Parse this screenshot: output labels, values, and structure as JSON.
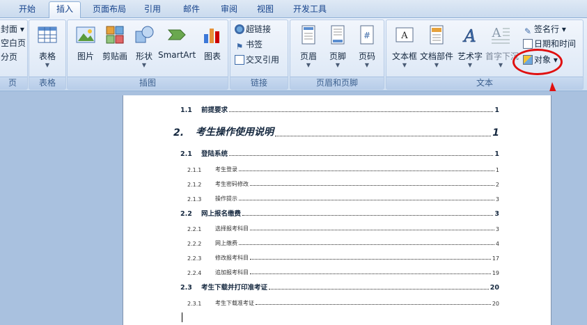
{
  "tabs": [
    "开始",
    "插入",
    "页面布局",
    "引用",
    "邮件",
    "审阅",
    "视图",
    "开发工具"
  ],
  "active_tab": "插入",
  "ribbon": {
    "pages_partial": [
      "封面",
      "空白页",
      "分页"
    ],
    "pages_label": "页",
    "table_group": {
      "button": "表格",
      "label": "表格"
    },
    "illustrations": {
      "buttons": [
        "图片",
        "剪贴画",
        "形状",
        "SmartArt",
        "图表"
      ],
      "label": "插图"
    },
    "links": {
      "buttons": [
        "超链接",
        "书签",
        "交叉引用"
      ],
      "label": "链接"
    },
    "header_footer": {
      "buttons": [
        "页眉",
        "页脚",
        "页码"
      ],
      "label": "页眉和页脚"
    },
    "text": {
      "buttons": [
        "文本框",
        "文档部件",
        "艺术字",
        "首字下沉"
      ],
      "small": [
        "签名行",
        "日期和时间",
        "对象"
      ],
      "label": "文本"
    }
  },
  "toc": [
    {
      "level": 2,
      "num": "1.1",
      "text": "前提要求",
      "page": "1"
    },
    {
      "level": 1,
      "num": "2.",
      "text": "考生操作使用说明",
      "page": "1"
    },
    {
      "level": 2,
      "num": "2.1",
      "text": "登陆系统",
      "page": "1"
    },
    {
      "level": 3,
      "num": "2.1.1",
      "text": "考生登录",
      "page": "1"
    },
    {
      "level": 3,
      "num": "2.1.2",
      "text": "考生密码修改",
      "page": "2"
    },
    {
      "level": 3,
      "num": "2.1.3",
      "text": "操作提示",
      "page": "3"
    },
    {
      "level": 2,
      "num": "2.2",
      "text": "网上报名缴费",
      "page": "3"
    },
    {
      "level": 3,
      "num": "2.2.1",
      "text": "选择报考科目",
      "page": "3"
    },
    {
      "level": 3,
      "num": "2.2.2",
      "text": "网上缴费",
      "page": "4"
    },
    {
      "level": 3,
      "num": "2.2.3",
      "text": "修改报考科目",
      "page": "17"
    },
    {
      "level": 3,
      "num": "2.2.4",
      "text": "追加报考科目",
      "page": "19"
    },
    {
      "level": 2,
      "num": "2.3",
      "text": "考生下载并打印准考证",
      "page": "20"
    },
    {
      "level": 3,
      "num": "2.3.1",
      "text": "考生下载准考证",
      "page": "20"
    }
  ],
  "annotation_color": "#e01010"
}
